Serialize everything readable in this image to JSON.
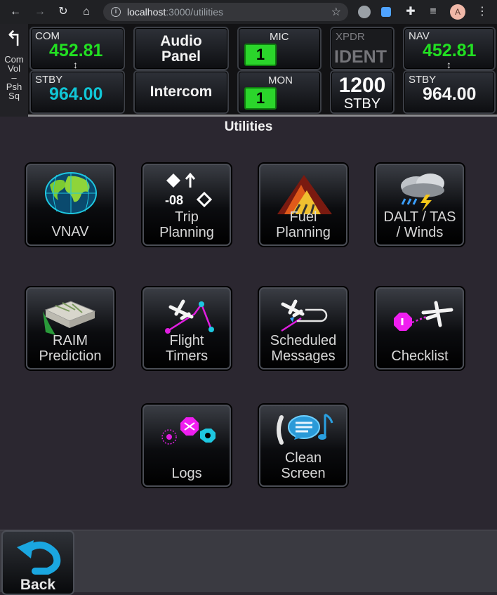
{
  "browser": {
    "url_host": "localhost",
    "url_path": ":3000/utilities",
    "avatar_letter": "A"
  },
  "topbar": {
    "comvol": {
      "line1": "Com",
      "line2": "Vol",
      "line3": "–",
      "line4": "Psh",
      "line5": "Sq"
    },
    "com": {
      "label": "COM",
      "active": "452.81",
      "stby_label": "STBY",
      "standby": "964.00"
    },
    "audio_panel": {
      "label_line1": "Audio",
      "label_line2": "Panel"
    },
    "intercom": {
      "label": "Intercom"
    },
    "mic": {
      "label": "MIC",
      "value": "1"
    },
    "mon": {
      "label": "MON",
      "value": "1"
    },
    "xpdr": {
      "label": "XPDR",
      "ident": "IDENT",
      "code": "1200",
      "mode": "STBY"
    },
    "nav": {
      "label": "NAV",
      "active": "452.81",
      "stby_label": "STBY",
      "standby": "964.00"
    }
  },
  "page_title": "Utilities",
  "tiles": [
    {
      "line1": "VNAV",
      "line2": "",
      "icon": "globe-icon"
    },
    {
      "line1": "Trip",
      "line2": "Planning",
      "icon": "trip-planning-icon",
      "icon_text": "-08"
    },
    {
      "line1": "Fuel",
      "line2": "Planning",
      "icon": "fuel-mountain-icon"
    },
    {
      "line1": "DALT / TAS",
      "line2": "/ Winds",
      "icon": "storm-cloud-icon"
    },
    {
      "line1": "RAIM",
      "line2": "Prediction",
      "icon": "map-icon"
    },
    {
      "line1": "Flight",
      "line2": "Timers",
      "icon": "flight-timers-icon"
    },
    {
      "line1": "Scheduled",
      "line2": "Messages",
      "icon": "scheduled-messages-icon"
    },
    {
      "line1": "Checklist",
      "line2": "",
      "icon": "checklist-icon"
    },
    {
      "line1": "Logs",
      "line2": "",
      "icon": "logs-icon"
    },
    {
      "line1": "Clean",
      "line2": "Screen",
      "icon": "clean-screen-icon"
    }
  ],
  "back": {
    "label": "Back"
  }
}
